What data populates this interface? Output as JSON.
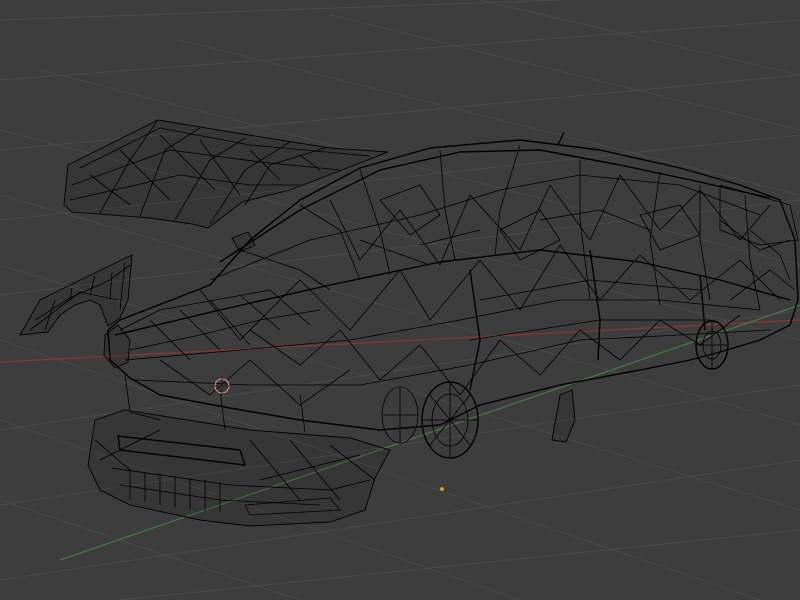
{
  "viewport": {
    "background_color": "#3d3d3d",
    "grid_color": "#4a4a4a",
    "x_axis_color": "#8a3535",
    "y_axis_color": "#3f7a3f",
    "wire_color": "#000000",
    "cursor_color": "#e07060",
    "origin_color": "#e8a020",
    "cursor_icon": "3d-cursor-icon",
    "origin_icon": "object-origin-icon"
  }
}
